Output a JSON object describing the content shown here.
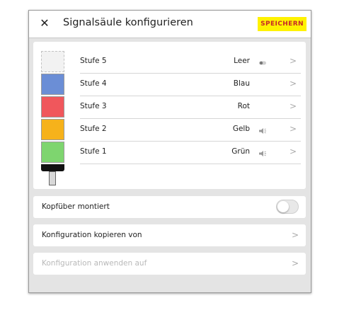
{
  "header": {
    "close_icon": "close-icon",
    "title": "Signalsäule konfigurieren",
    "save_label": "SPEICHERN"
  },
  "tower": {
    "segments": [
      {
        "name": "Stufe 5",
        "value": "Leer",
        "color": ""
      },
      {
        "name": "Stufe 4",
        "value": "Blau",
        "color": "#6b8ed6"
      },
      {
        "name": "Stufe 3",
        "value": "Rot",
        "color": "#f0575c"
      },
      {
        "name": "Stufe 2",
        "value": "Gelb",
        "color": "#f6b21b"
      },
      {
        "name": "Stufe 1",
        "value": "Grün",
        "color": "#7ed56f"
      }
    ]
  },
  "stages": [
    {
      "label": "Stufe 5",
      "value": "Leer",
      "icon": "toggle-icon"
    },
    {
      "label": "Stufe 4",
      "value": "Blau",
      "icon": ""
    },
    {
      "label": "Stufe 3",
      "value": "Rot",
      "icon": ""
    },
    {
      "label": "Stufe 2",
      "value": "Gelb",
      "icon": "horn-icon"
    },
    {
      "label": "Stufe 1",
      "value": "Grün",
      "icon": "horn-icon"
    }
  ],
  "options": {
    "mount_label": "Kopfüber montiert",
    "mount_enabled": false,
    "copy_label": "Konfiguration kopieren von",
    "apply_label": "Konfiguration anwenden auf"
  }
}
